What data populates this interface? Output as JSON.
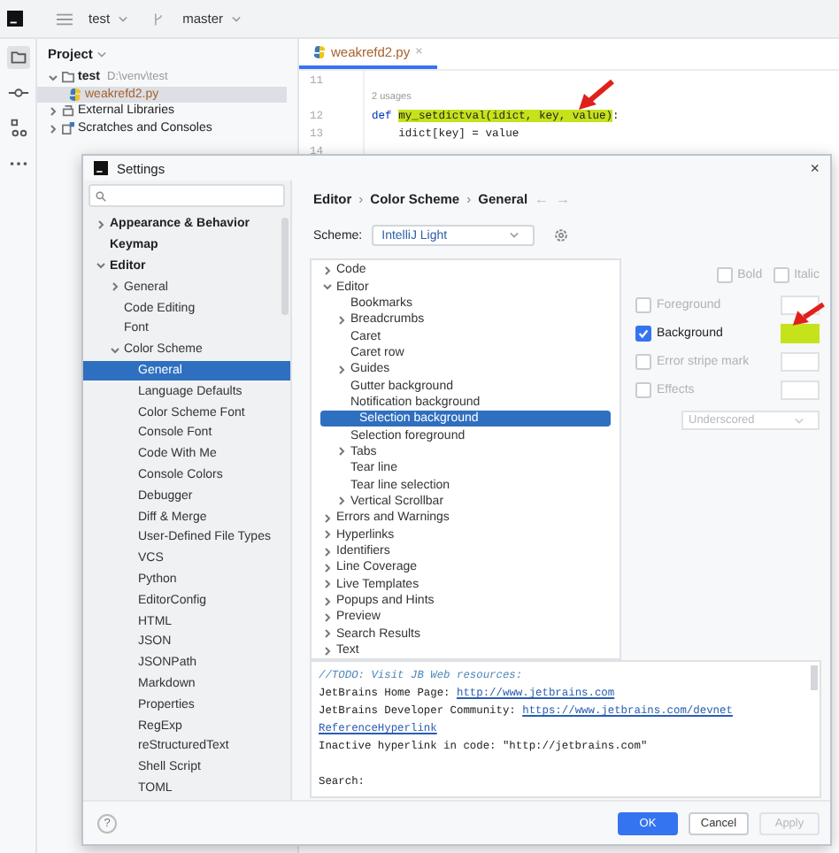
{
  "toolbar": {
    "project": "test",
    "branch": "master"
  },
  "project_panel": {
    "title": "Project",
    "tree": [
      {
        "label": "test",
        "path": "D:\\venv\\test",
        "kind": "folder",
        "expanded": true,
        "selected": false,
        "children": [
          {
            "label": "weakrefd2.py",
            "kind": "python",
            "selected": true
          }
        ]
      },
      {
        "label": "External Libraries",
        "kind": "library",
        "expanded": false,
        "selected": false
      },
      {
        "label": "Scratches and Consoles",
        "kind": "scratch",
        "expanded": false,
        "selected": false
      }
    ]
  },
  "editor": {
    "tab": {
      "label": "weakrefd2.py",
      "close": "×"
    },
    "lines": [
      {
        "kind": "code",
        "number": "11"
      },
      {
        "kind": "hint",
        "text": "2 usages"
      },
      {
        "kind": "code",
        "number": "12",
        "segments": [
          {
            "kind": "keyword",
            "text": "def "
          },
          {
            "kind": "highlight",
            "text": "my_setdictval(idict, key, value)"
          },
          {
            "kind": "plain",
            "text": ":"
          }
        ]
      },
      {
        "kind": "code",
        "number": "13",
        "segments": [
          {
            "kind": "plain",
            "text": "    idict[key] = value"
          }
        ]
      },
      {
        "kind": "code",
        "number": "14"
      }
    ]
  },
  "dialog": {
    "title": "Settings",
    "close": "×",
    "sidebar": [
      {
        "label": "Appearance & Behavior",
        "expanded": false,
        "selected": false
      },
      {
        "label": "Keymap",
        "selected": false
      },
      {
        "label": "Editor",
        "expanded": true,
        "selected": false,
        "children": [
          {
            "label": "General",
            "expanded": false,
            "selected": false
          },
          {
            "label": "Code Editing",
            "selected": false
          },
          {
            "label": "Font",
            "selected": false
          },
          {
            "label": "Color Scheme",
            "expanded": true,
            "selected": false,
            "children": [
              {
                "label": "General",
                "selected": true
              },
              {
                "label": "Language Defaults",
                "selected": false
              },
              {
                "label": "Color Scheme Font",
                "selected": false
              },
              {
                "label": "Console Font",
                "selected": false
              },
              {
                "label": "Code With Me",
                "selected": false
              },
              {
                "label": "Console Colors",
                "selected": false
              },
              {
                "label": "Debugger",
                "selected": false
              },
              {
                "label": "Diff & Merge",
                "selected": false
              },
              {
                "label": "User-Defined File Types",
                "selected": false
              },
              {
                "label": "VCS",
                "selected": false
              },
              {
                "label": "Python",
                "selected": false
              },
              {
                "label": "EditorConfig",
                "selected": false
              },
              {
                "label": "HTML",
                "selected": false
              },
              {
                "label": "JSON",
                "selected": false
              },
              {
                "label": "JSONPath",
                "selected": false
              },
              {
                "label": "Markdown",
                "selected": false
              },
              {
                "label": "Properties",
                "selected": false
              },
              {
                "label": "RegExp",
                "selected": false
              },
              {
                "label": "reStructuredText",
                "selected": false
              },
              {
                "label": "Shell Script",
                "selected": false
              },
              {
                "label": "TOML",
                "selected": false
              }
            ]
          }
        ]
      }
    ],
    "breadcrumb": [
      "Editor",
      "Color Scheme",
      "General"
    ],
    "breadcrumb_separator": "›",
    "back": "←",
    "forward": "→",
    "scheme": {
      "label": "Scheme:",
      "value": "IntelliJ Light"
    },
    "attribute_tree": [
      {
        "label": "Code",
        "expanded": false,
        "selected": false
      },
      {
        "label": "Editor",
        "expanded": true,
        "selected": false,
        "children": [
          {
            "label": "Bookmarks",
            "selected": false
          },
          {
            "label": "Breadcrumbs",
            "expanded": false,
            "selected": false
          },
          {
            "label": "Caret",
            "selected": false
          },
          {
            "label": "Caret row",
            "selected": false
          },
          {
            "label": "Guides",
            "expanded": false,
            "selected": false
          },
          {
            "label": "Gutter background",
            "selected": false
          },
          {
            "label": "Notification background",
            "selected": false
          },
          {
            "label": "Selection background",
            "selected": true
          },
          {
            "label": "Selection foreground",
            "selected": false
          },
          {
            "label": "Tabs",
            "expanded": false,
            "selected": false
          },
          {
            "label": "Tear line",
            "selected": false
          },
          {
            "label": "Tear line selection",
            "selected": false
          },
          {
            "label": "Vertical Scrollbar",
            "expanded": false,
            "selected": false
          }
        ]
      },
      {
        "label": "Errors and Warnings",
        "expanded": false,
        "selected": false
      },
      {
        "label": "Hyperlinks",
        "expanded": false,
        "selected": false
      },
      {
        "label": "Identifiers",
        "expanded": false,
        "selected": false
      },
      {
        "label": "Line Coverage",
        "expanded": false,
        "selected": false
      },
      {
        "label": "Live Templates",
        "expanded": false,
        "selected": false
      },
      {
        "label": "Popups and Hints",
        "expanded": false,
        "selected": false
      },
      {
        "label": "Preview",
        "expanded": false,
        "selected": false
      },
      {
        "label": "Search Results",
        "expanded": false,
        "selected": false
      },
      {
        "label": "Text",
        "expanded": false,
        "selected": false
      }
    ],
    "font_styles": [
      {
        "label": "Bold",
        "checked": false
      },
      {
        "label": "Italic",
        "checked": false
      }
    ],
    "attributes": [
      {
        "label": "Foreground",
        "checked": false
      },
      {
        "label": "Background",
        "checked": true
      },
      {
        "label": "Error stripe mark",
        "checked": false
      },
      {
        "label": "Effects",
        "checked": false
      }
    ],
    "effect_type": "Underscored",
    "preview": [
      {
        "kind": "text",
        "segments": [
          {
            "kind": "comment",
            "text": "//TODO: Visit JB Web resources:"
          }
        ]
      },
      {
        "kind": "text",
        "segments": [
          {
            "kind": "plain",
            "text": "JetBrains Home Page: "
          },
          {
            "kind": "link",
            "text": "http://www.jetbrains.com"
          }
        ]
      },
      {
        "kind": "text",
        "segments": [
          {
            "kind": "plain",
            "text": "JetBrains Developer Community: "
          },
          {
            "kind": "link",
            "text": "https://www.jetbrains.com/devnet"
          }
        ]
      },
      {
        "kind": "text",
        "segments": [
          {
            "kind": "hyperlink",
            "text": "ReferenceHyperlink"
          }
        ]
      },
      {
        "kind": "text",
        "segments": [
          {
            "kind": "plain",
            "text": "Inactive hyperlink in code: \"http://jetbrains.com\""
          }
        ]
      },
      {
        "kind": "blank"
      },
      {
        "kind": "text",
        "segments": [
          {
            "kind": "plain",
            "text": "Search:"
          }
        ]
      }
    ],
    "help": "?",
    "buttons": [
      {
        "label": "OK",
        "kind": "primary"
      },
      {
        "label": "Cancel",
        "kind": "normal"
      },
      {
        "label": "Apply",
        "kind": "disabled"
      }
    ]
  }
}
